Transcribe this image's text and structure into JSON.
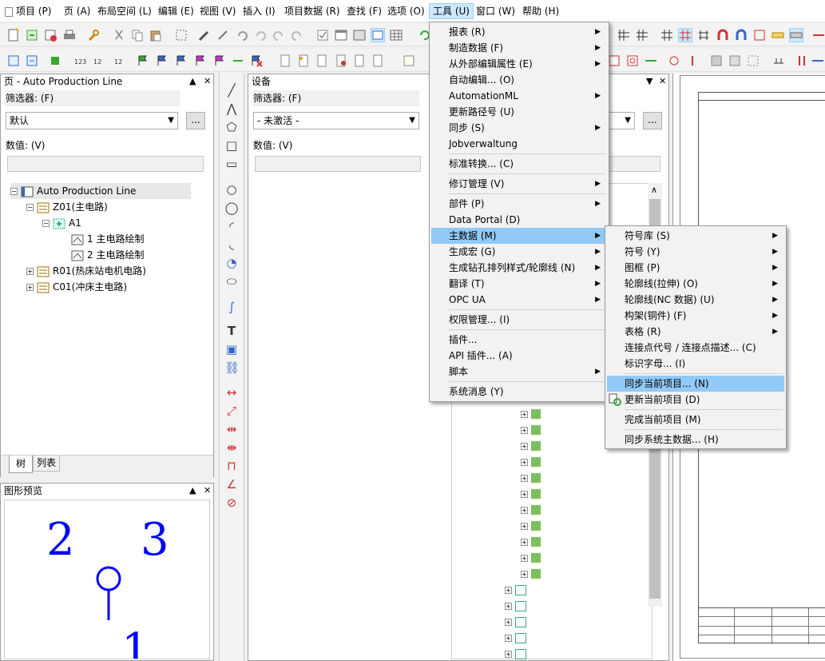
{
  "menubar": {
    "items": [
      {
        "label": "项目 (P)"
      },
      {
        "label": "页 (A)"
      },
      {
        "label": "布局空间 (L)"
      },
      {
        "label": "编辑 (E)"
      },
      {
        "label": "视图 (V)"
      },
      {
        "label": "插入 (I)"
      },
      {
        "label": "项目数据 (R)"
      },
      {
        "label": "查找 (F)"
      },
      {
        "label": "选项 (O)"
      },
      {
        "label": "工具 (U)"
      },
      {
        "label": "窗口 (W)"
      },
      {
        "label": "帮助 (H)"
      }
    ]
  },
  "page_panel": {
    "title": "页 - Auto Production Line",
    "filter_label": "筛选器: (F)",
    "filter_value": "默认",
    "value_label": "数值: (V)",
    "more_button": "...",
    "tree": {
      "root": "Auto Production Line",
      "z01": "Z01(主电路)",
      "a1": "A1",
      "page1": "1 主电路绘制",
      "page2": "2 主电路绘制",
      "r01": "R01(热床站电机电路)",
      "c01": "C01(冲床主电路)"
    },
    "tabs": [
      "树",
      "列表"
    ]
  },
  "preview_panel": {
    "title": "图形预览",
    "numbers": [
      "2",
      "3",
      "1"
    ]
  },
  "device_panel": {
    "title": "设备",
    "filter_label": "筛选器: (F)",
    "filter_value": "- 未激活 -",
    "value_label": "数值: (V)",
    "more_button": "..."
  },
  "tools_menu": {
    "items": [
      {
        "label": "报表 (R)",
        "sub": true
      },
      {
        "label": "制造数据 (F)",
        "sub": true
      },
      {
        "label": "从外部编辑属性 (E)",
        "sub": true
      },
      {
        "label": "自动编辑... (O)",
        "sub": false
      },
      {
        "label": "AutomationML",
        "sub": true
      },
      {
        "label": "更新路径号 (U)",
        "sub": false
      },
      {
        "label": "同步 (S)",
        "sub": true
      },
      {
        "label": "Jobverwaltung",
        "sub": false
      },
      {
        "label": "标准转换... (C)",
        "sub": false
      },
      {
        "label": "修订管理 (V)",
        "sub": true
      },
      {
        "label": "部件 (P)",
        "sub": true
      },
      {
        "label": "Data Portal (D)",
        "sub": false
      },
      {
        "label": "主数据 (M)",
        "sub": true
      },
      {
        "label": "生成宏 (G)",
        "sub": true
      },
      {
        "label": "生成钻孔排列样式/轮廓线 (N)",
        "sub": true
      },
      {
        "label": "翻译 (T)",
        "sub": true
      },
      {
        "label": "OPC UA",
        "sub": true
      },
      {
        "label": "权限管理... (I)",
        "sub": false
      },
      {
        "label": "插件...",
        "sub": false
      },
      {
        "label": "API 插件... (A)",
        "sub": false
      },
      {
        "label": "脚本",
        "sub": true
      },
      {
        "label": "系统消息 (Y)",
        "sub": false
      }
    ]
  },
  "masterdata_menu": {
    "items": [
      {
        "label": "符号库 (S)",
        "sub": true
      },
      {
        "label": "符号 (Y)",
        "sub": true
      },
      {
        "label": "图框 (P)",
        "sub": true
      },
      {
        "label": "轮廓线(拉伸) (O)",
        "sub": true
      },
      {
        "label": "轮廓线(NC 数据) (U)",
        "sub": true
      },
      {
        "label": "构架(铜件) (F)",
        "sub": true
      },
      {
        "label": "表格 (R)",
        "sub": true
      },
      {
        "label": "连接点代号 / 连接点描述... (C)",
        "sub": false
      },
      {
        "label": "标识字母... (I)",
        "sub": false
      },
      {
        "label": "同步当前项目... (N)",
        "sub": false
      },
      {
        "label": "更新当前项目 (D)",
        "sub": false
      },
      {
        "label": "完成当前项目 (M)",
        "sub": false
      },
      {
        "label": "同步系统主数据... (H)",
        "sub": false
      }
    ]
  },
  "colors": {
    "menu_highlight": "#91c9f7",
    "active_menu": "#cce8ff",
    "preview_symbol": "#0000ff"
  }
}
